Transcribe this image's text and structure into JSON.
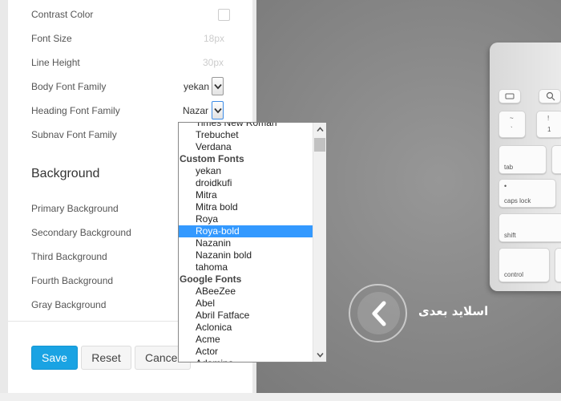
{
  "settings": {
    "contrast_color_label": "Contrast Color",
    "font_size_label": "Font Size",
    "font_size_value": "18px",
    "line_height_label": "Line Height",
    "line_height_value": "30px",
    "body_font_label": "Body Font Family",
    "body_font_value": "yekan",
    "heading_font_label": "Heading Font Family",
    "heading_font_value": "Nazar",
    "subnav_font_label": "Subnav Font Family"
  },
  "background": {
    "title": "Background",
    "items": [
      "Primary Background",
      "Secondary Background",
      "Third Background",
      "Fourth Background",
      "Gray Background"
    ]
  },
  "buttons": {
    "save": "Save",
    "reset": "Reset",
    "cancel": "Cancel"
  },
  "dropdown": {
    "items": [
      {
        "label": "Times New Roman",
        "group": false
      },
      {
        "label": "Trebuchet",
        "group": false
      },
      {
        "label": "Verdana",
        "group": false
      },
      {
        "label": "Custom Fonts",
        "group": true
      },
      {
        "label": "yekan",
        "group": false
      },
      {
        "label": "droidkufi",
        "group": false
      },
      {
        "label": "Mitra",
        "group": false
      },
      {
        "label": "Mitra bold",
        "group": false
      },
      {
        "label": "Roya",
        "group": false
      },
      {
        "label": "Roya-bold",
        "group": false,
        "selected": true
      },
      {
        "label": "Nazanin",
        "group": false
      },
      {
        "label": "Nazanin bold",
        "group": false
      },
      {
        "label": "tahoma",
        "group": false
      },
      {
        "label": "Google Fonts",
        "group": true
      },
      {
        "label": "ABeeZee",
        "group": false
      },
      {
        "label": "Abel",
        "group": false
      },
      {
        "label": "Abril Fatface",
        "group": false
      },
      {
        "label": "Aclonica",
        "group": false
      },
      {
        "label": "Acme",
        "group": false
      },
      {
        "label": "Actor",
        "group": false
      },
      {
        "label": "Adamina",
        "group": false
      }
    ]
  },
  "slide": {
    "next_label": "اسلاید بعدی",
    "keyboard_keys": [
      "~",
      "`",
      "!",
      "1",
      "tab",
      "caps lock",
      "shift",
      "control"
    ]
  },
  "colors": {
    "accent": "#1aa3e3",
    "selected_item": "#3399ff"
  }
}
